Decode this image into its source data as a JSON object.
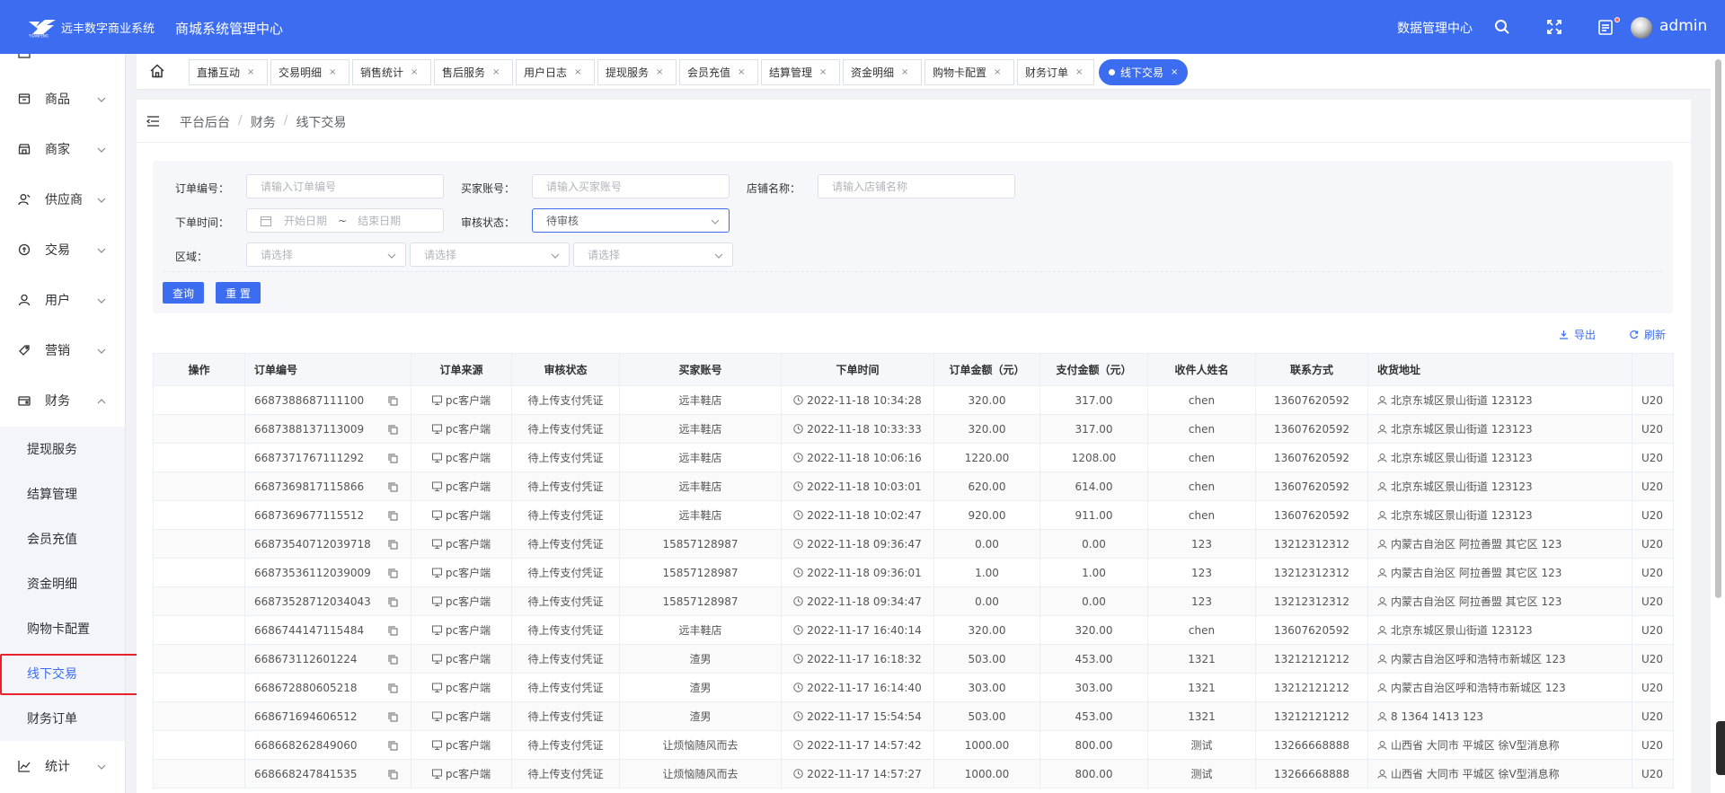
{
  "header": {
    "logo_text": "远丰数字商业系统",
    "system_title": "商城系统管理中心",
    "data_center": "数据管理中心",
    "admin": "admin"
  },
  "sidebar": {
    "items": [
      {
        "label": "商品",
        "icon": "product-icon"
      },
      {
        "label": "商家",
        "icon": "store-icon"
      },
      {
        "label": "供应商",
        "icon": "supplier-icon"
      },
      {
        "label": "交易",
        "icon": "trade-icon"
      },
      {
        "label": "用户",
        "icon": "user-icon"
      },
      {
        "label": "营销",
        "icon": "marketing-icon"
      },
      {
        "label": "财务",
        "icon": "finance-icon"
      }
    ],
    "sub_items": [
      "提现服务",
      "结算管理",
      "会员充值",
      "资金明细",
      "购物卡配置",
      "线下交易",
      "财务订单"
    ],
    "bottom_item": "统计"
  },
  "tabs": [
    "直播互动",
    "交易明细",
    "销售统计",
    "售后服务",
    "用户日志",
    "提现服务",
    "会员充值",
    "结算管理",
    "资金明细",
    "购物卡配置",
    "财务订单",
    "线下交易"
  ],
  "breadcrumb": [
    "平台后台",
    "财务",
    "线下交易"
  ],
  "filter": {
    "order_no_label": "订单编号：",
    "order_no_placeholder": "请输入订单编号",
    "buyer_label": "买家账号：",
    "buyer_placeholder": "请输入买家账号",
    "shop_label": "店铺名称：",
    "shop_placeholder": "请输入店铺名称",
    "time_label": "下单时间：",
    "start_placeholder": "开始日期",
    "range_sep": "~",
    "end_placeholder": "结束日期",
    "audit_label": "审核状态：",
    "audit_value": "待审核",
    "region_label": "区域：",
    "region_placeholder": "请选择",
    "query": "查询",
    "reset": "重 置"
  },
  "tools": {
    "export": "导出",
    "refresh": "刷新"
  },
  "table": {
    "columns": [
      "操作",
      "订单编号",
      "订单来源",
      "审核状态",
      "买家账号",
      "下单时间",
      "订单金额（元）",
      "支付金额（元）",
      "收件人姓名",
      "联系方式",
      "收货地址"
    ],
    "rows": [
      {
        "order": "6687388687111100",
        "source": "pc客户端",
        "status": "待上传支付凭证",
        "buyer": "远丰鞋店",
        "time": "2022-11-18 10:34:28",
        "amount": "320.00",
        "paid": "317.00",
        "name": "chen",
        "phone": "13607620592",
        "addr": "北京东城区景山街道 123123",
        "extra": "U20"
      },
      {
        "order": "6687388137113009",
        "source": "pc客户端",
        "status": "待上传支付凭证",
        "buyer": "远丰鞋店",
        "time": "2022-11-18 10:33:33",
        "amount": "320.00",
        "paid": "317.00",
        "name": "chen",
        "phone": "13607620592",
        "addr": "北京东城区景山街道 123123",
        "extra": "U20"
      },
      {
        "order": "6687371767111292",
        "source": "pc客户端",
        "status": "待上传支付凭证",
        "buyer": "远丰鞋店",
        "time": "2022-11-18 10:06:16",
        "amount": "1220.00",
        "paid": "1208.00",
        "name": "chen",
        "phone": "13607620592",
        "addr": "北京东城区景山街道 123123",
        "extra": "U20"
      },
      {
        "order": "6687369817115866",
        "source": "pc客户端",
        "status": "待上传支付凭证",
        "buyer": "远丰鞋店",
        "time": "2022-11-18 10:03:01",
        "amount": "620.00",
        "paid": "614.00",
        "name": "chen",
        "phone": "13607620592",
        "addr": "北京东城区景山街道 123123",
        "extra": "U20"
      },
      {
        "order": "6687369677115512",
        "source": "pc客户端",
        "status": "待上传支付凭证",
        "buyer": "远丰鞋店",
        "time": "2022-11-18 10:02:47",
        "amount": "920.00",
        "paid": "911.00",
        "name": "chen",
        "phone": "13607620592",
        "addr": "北京东城区景山街道 123123",
        "extra": "U20"
      },
      {
        "order": "66873540712039718",
        "source": "pc客户端",
        "status": "待上传支付凭证",
        "buyer": "15857128987",
        "time": "2022-11-18 09:36:47",
        "amount": "0.00",
        "paid": "0.00",
        "name": "123",
        "phone": "13212312312",
        "addr": "内蒙古自治区 阿拉善盟 其它区 123",
        "extra": "U20"
      },
      {
        "order": "66873536112039009",
        "source": "pc客户端",
        "status": "待上传支付凭证",
        "buyer": "15857128987",
        "time": "2022-11-18 09:36:01",
        "amount": "1.00",
        "paid": "1.00",
        "name": "123",
        "phone": "13212312312",
        "addr": "内蒙古自治区 阿拉善盟 其它区 123",
        "extra": "U20"
      },
      {
        "order": "66873528712034043",
        "source": "pc客户端",
        "status": "待上传支付凭证",
        "buyer": "15857128987",
        "time": "2022-11-18 09:34:47",
        "amount": "0.00",
        "paid": "0.00",
        "name": "123",
        "phone": "13212312312",
        "addr": "内蒙古自治区 阿拉善盟 其它区 123",
        "extra": "U20"
      },
      {
        "order": "6686744147115484",
        "source": "pc客户端",
        "status": "待上传支付凭证",
        "buyer": "远丰鞋店",
        "time": "2022-11-17 16:40:14",
        "amount": "320.00",
        "paid": "320.00",
        "name": "chen",
        "phone": "13607620592",
        "addr": "北京东城区景山街道 123123",
        "extra": "U20"
      },
      {
        "order": "668673112601224",
        "source": "pc客户端",
        "status": "待上传支付凭证",
        "buyer": "渣男",
        "time": "2022-11-17 16:18:32",
        "amount": "503.00",
        "paid": "453.00",
        "name": "1321",
        "phone": "13212121212",
        "addr": "内蒙古自治区呼和浩特市新城区 123",
        "extra": "U20"
      },
      {
        "order": "668672880605218",
        "source": "pc客户端",
        "status": "待上传支付凭证",
        "buyer": "渣男",
        "time": "2022-11-17 16:14:40",
        "amount": "303.00",
        "paid": "303.00",
        "name": "1321",
        "phone": "13212121212",
        "addr": "内蒙古自治区呼和浩特市新城区 123",
        "extra": "U20"
      },
      {
        "order": "668671694606512",
        "source": "pc客户端",
        "status": "待上传支付凭证",
        "buyer": "渣男",
        "time": "2022-11-17 15:54:54",
        "amount": "503.00",
        "paid": "453.00",
        "name": "1321",
        "phone": "13212121212",
        "addr": "8 1364 1413 123",
        "extra": "U20"
      },
      {
        "order": "668668262849060",
        "source": "pc客户端",
        "status": "待上传支付凭证",
        "buyer": "让烦恼随风而去",
        "time": "2022-11-17 14:57:42",
        "amount": "1000.00",
        "paid": "800.00",
        "name": "测试",
        "phone": "13266668888",
        "addr": "山西省 大同市 平城区 徐V型消息称",
        "extra": "U20"
      },
      {
        "order": "668668247841535",
        "source": "pc客户端",
        "status": "待上传支付凭证",
        "buyer": "让烦恼随风而去",
        "time": "2022-11-17 14:57:27",
        "amount": "1000.00",
        "paid": "800.00",
        "name": "测试",
        "phone": "13266668888",
        "addr": "山西省 大同市 平城区 徐V型消息称",
        "extra": "U20"
      }
    ]
  }
}
